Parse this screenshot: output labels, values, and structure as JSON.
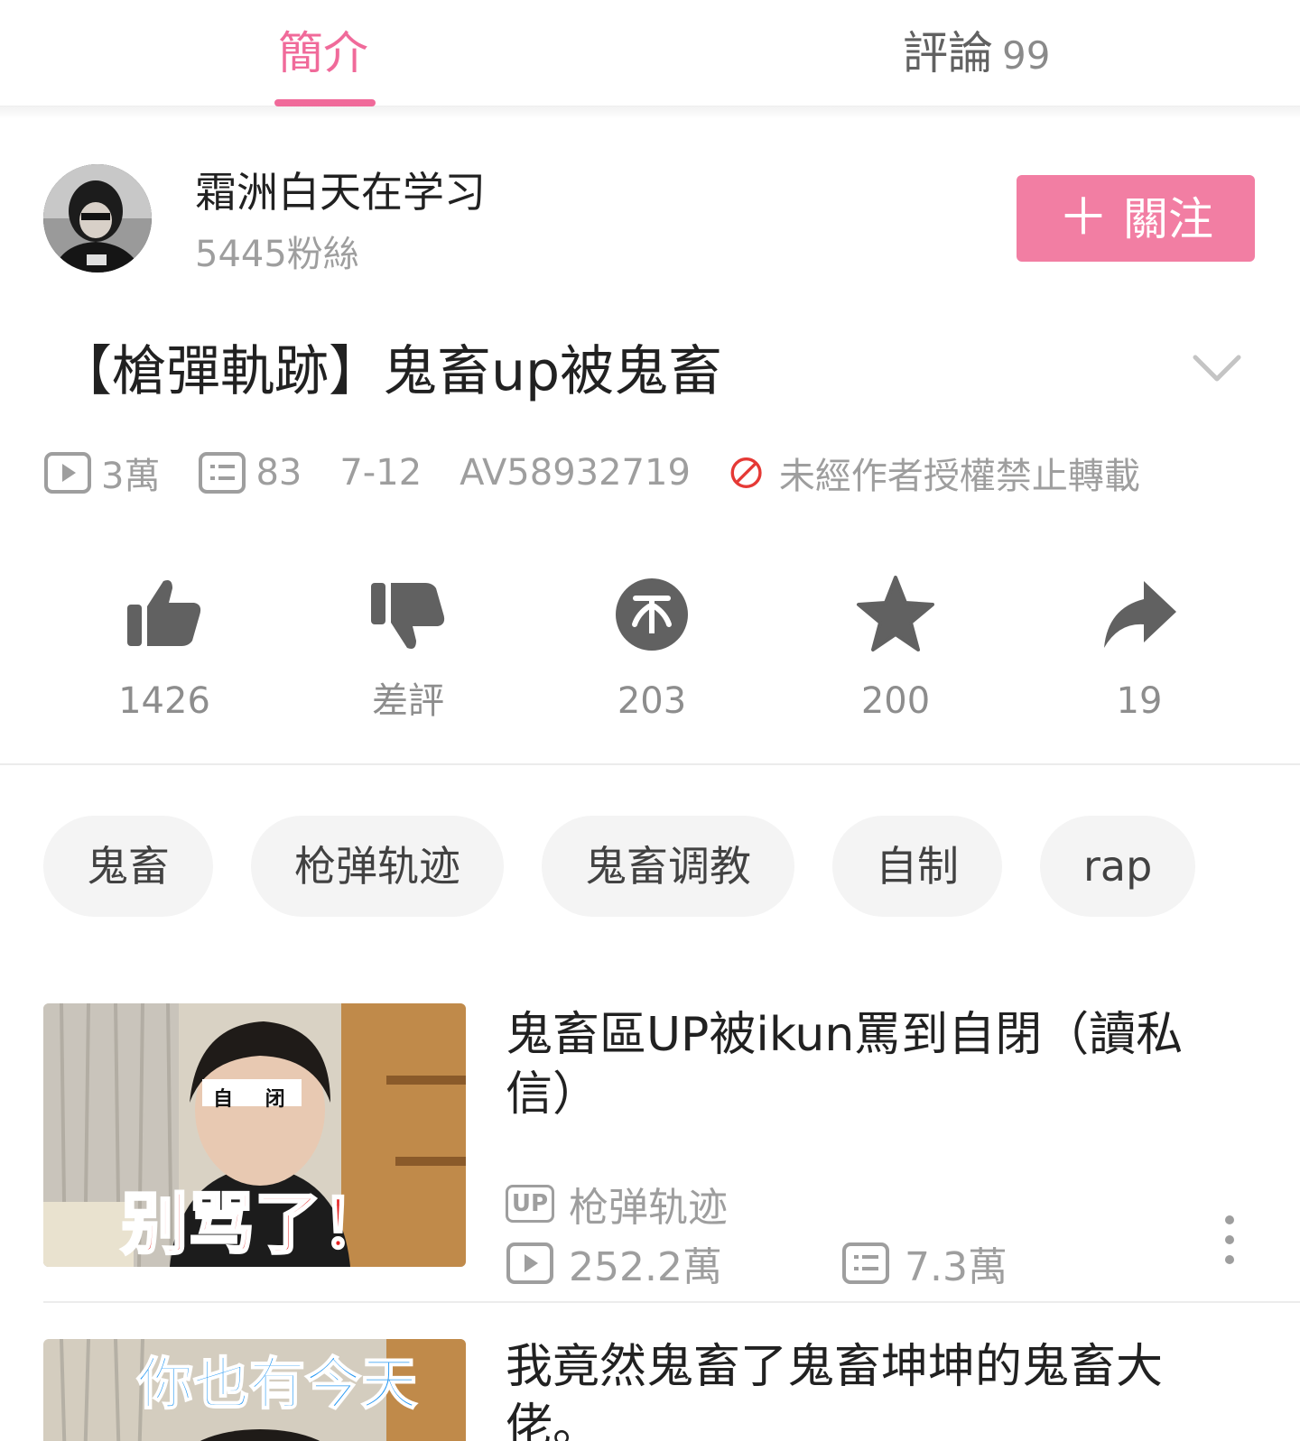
{
  "tabs": {
    "intro": "簡介",
    "comments": "評論",
    "comments_count": "99"
  },
  "uploader": {
    "name": "霜洲白天在学习",
    "fans": "5445粉絲",
    "follow_plus": "＋",
    "follow_label": "關注"
  },
  "video": {
    "title": "【槍彈軌跡】鬼畜up被鬼畜",
    "views": "3萬",
    "danmaku": "83",
    "date": "7-12",
    "av": "AV58932719",
    "copyright": "未經作者授權禁止轉載"
  },
  "actions": {
    "like": "1426",
    "dislike": "差評",
    "coin": "203",
    "favorite": "200",
    "share": "19"
  },
  "tags": [
    "鬼畜",
    "枪弹轨迹",
    "鬼畜调教",
    "自制",
    "rap"
  ],
  "related": [
    {
      "title": "鬼畜區UP被ikun罵到自閉（讀私信）",
      "up_badge": "UP",
      "up": "枪弹轨迹",
      "views": "252.2萬",
      "danmaku": "7.3萬",
      "thumb_caption_top": "自 闭",
      "thumb_caption": "别骂了！"
    },
    {
      "title": "我竟然鬼畜了鬼畜坤坤的鬼畜大佬。",
      "thumb_caption": "你也有今天"
    }
  ],
  "colors": {
    "accent": "#f06a9a",
    "follow_bg": "#f27ea3",
    "ban_red": "#e53935",
    "icon_gray": "#616161"
  }
}
